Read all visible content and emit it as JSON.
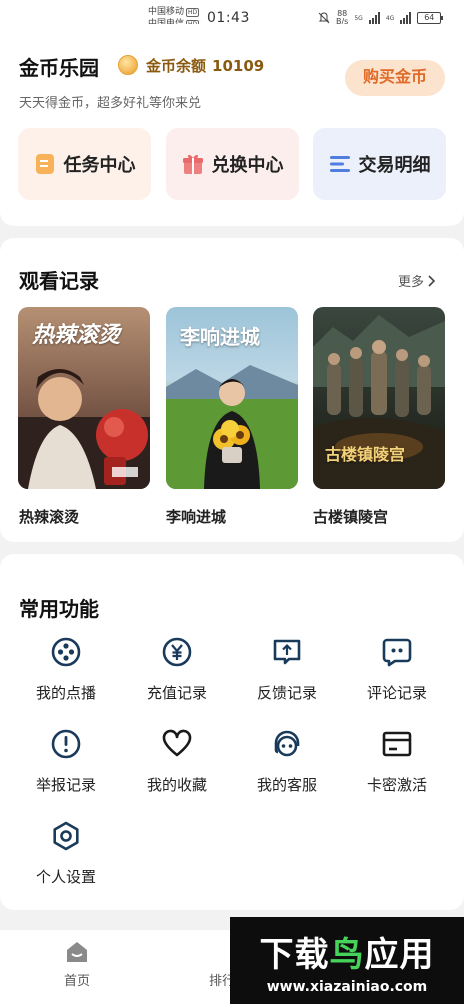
{
  "status_bar": {
    "carrier1": "中国移动",
    "carrier2": "中国电信",
    "hd": "HD",
    "time": "01:43",
    "net_speed": "88",
    "net_unit": "B/s",
    "sig1": "5G",
    "sig2": "4G",
    "battery": "64"
  },
  "header": {
    "title": "金币乐园",
    "balance_label": "金币余额",
    "balance_value": "10109",
    "buy_button": "购买金币",
    "subtitle": "天天得金币，超多好礼等你来兑"
  },
  "quick_actions": [
    {
      "label": "任务中心",
      "icon": "task-icon",
      "color": "#f29a45"
    },
    {
      "label": "兑换中心",
      "icon": "gift-icon",
      "color": "#e86a6a"
    },
    {
      "label": "交易明细",
      "icon": "list-icon",
      "color": "#4f7de0"
    }
  ],
  "watch_history": {
    "title": "观看记录",
    "more": "更多",
    "items": [
      {
        "title": "热辣滚烫",
        "poster_text": "热辣滚烫"
      },
      {
        "title": "李响进城",
        "poster_text": "李响进城"
      },
      {
        "title": "古楼镇陵宫",
        "poster_text": "古楼镇陵宫"
      }
    ]
  },
  "functions": {
    "title": "常用功能",
    "items": [
      {
        "label": "我的点播",
        "icon": "film-reel-icon"
      },
      {
        "label": "充值记录",
        "icon": "yuan-coin-icon"
      },
      {
        "label": "反馈记录",
        "icon": "feedback-icon"
      },
      {
        "label": "评论记录",
        "icon": "comment-icon"
      },
      {
        "label": "举报记录",
        "icon": "report-icon"
      },
      {
        "label": "我的收藏",
        "icon": "heart-icon"
      },
      {
        "label": "我的客服",
        "icon": "headset-icon"
      },
      {
        "label": "卡密激活",
        "icon": "card-icon"
      },
      {
        "label": "个人设置",
        "icon": "settings-icon"
      }
    ]
  },
  "tabbar": {
    "home": "首页",
    "rank": "排行"
  },
  "watermark": {
    "title_a": "下载",
    "title_b": "鸟",
    "title_c": "应用",
    "url": "www.xiazainiao.com"
  }
}
